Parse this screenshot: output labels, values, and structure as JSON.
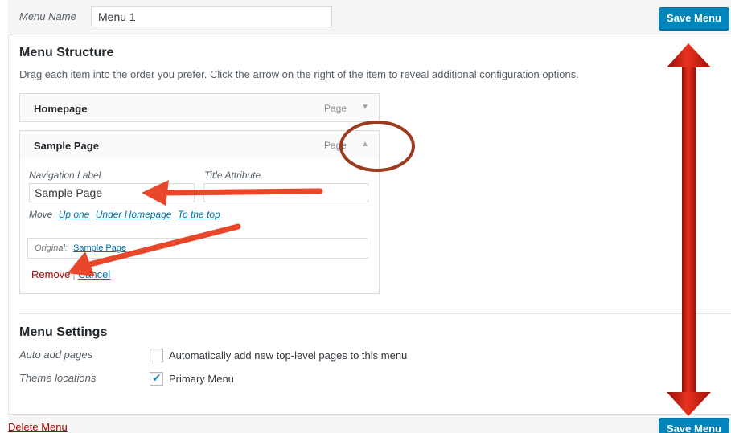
{
  "header": {
    "menu_name_label": "Menu Name",
    "menu_name_value": "Menu 1",
    "save_label": "Save Menu"
  },
  "structure": {
    "title": "Menu Structure",
    "description": "Drag each item into the order you prefer. Click the arrow on the right of the item to reveal additional configuration options.",
    "items": [
      {
        "title": "Homepage",
        "type": "Page",
        "arrow": "▼"
      },
      {
        "title": "Sample Page",
        "type": "Page",
        "arrow": "▲"
      }
    ],
    "settings": {
      "nav_label_label": "Navigation Label",
      "nav_label_value": "Sample Page",
      "title_attr_label": "Title Attribute",
      "title_attr_value": "",
      "move_label": "Move",
      "move_links": [
        "Up one",
        "Under Homepage",
        "To the top"
      ],
      "original_label": "Original:",
      "original_link": "Sample Page",
      "remove_label": "Remove",
      "separator": "|",
      "cancel_label": "Cancel"
    }
  },
  "menu_settings": {
    "title": "Menu Settings",
    "auto_add_label": "Auto add pages",
    "auto_add_text": "Automatically add new top-level pages to this menu",
    "auto_add_checked": false,
    "theme_locations_label": "Theme locations",
    "primary_menu_text": "Primary Menu",
    "primary_menu_checked": true,
    "checkmark": "✔"
  },
  "footer": {
    "delete_label": "Delete Menu",
    "save_label": "Save Menu"
  },
  "colors": {
    "primary_button": "#0085ba",
    "link": "#0073aa",
    "delete": "#aa0000",
    "annotation_arrow": "#e8472b",
    "annotation_circle": "#9b3a1f",
    "double_arrow": "#c81d0e"
  }
}
